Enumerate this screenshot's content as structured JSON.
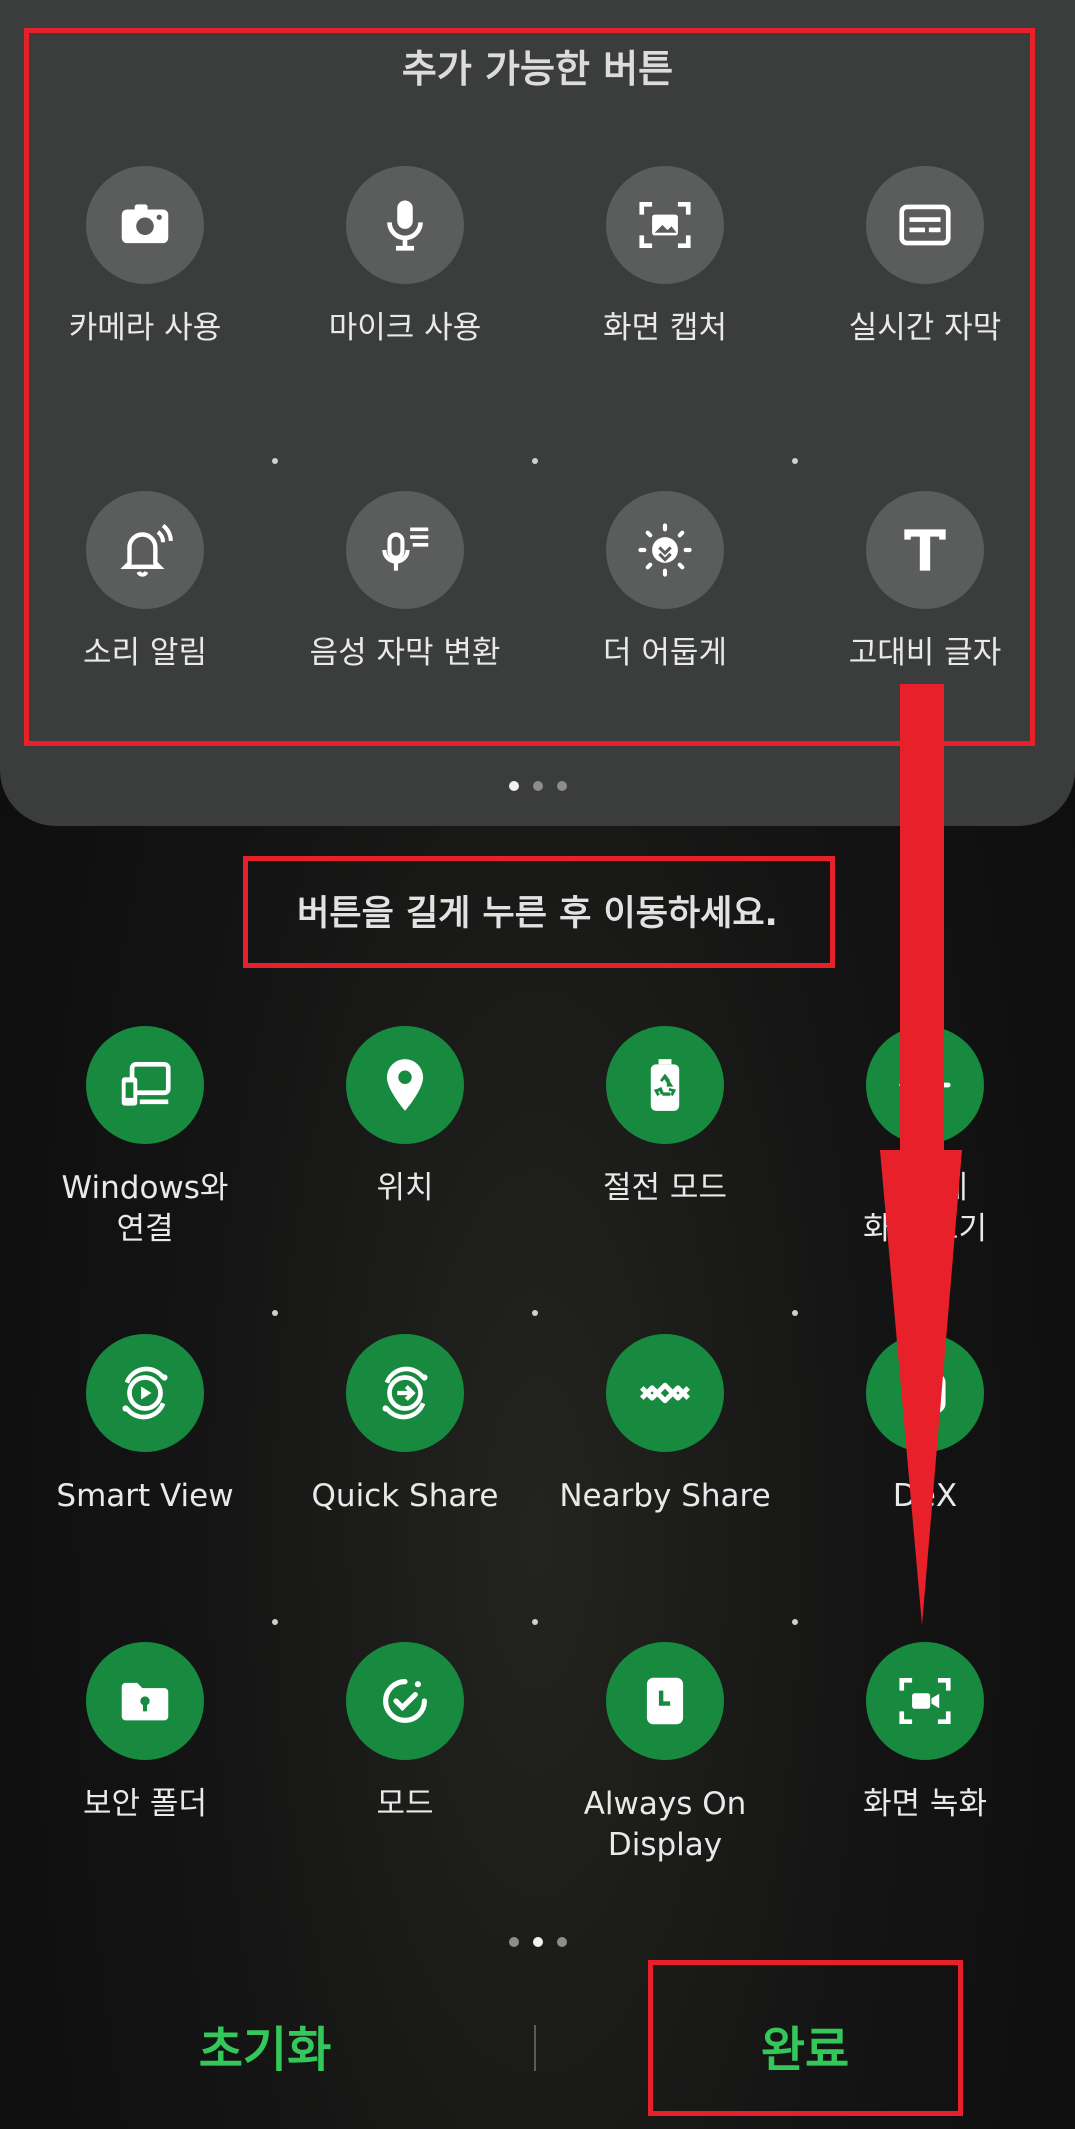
{
  "available_panel": {
    "title": "추가 가능한 버튼",
    "buttons": [
      {
        "label": "카메라 사용",
        "icon": "camera-icon"
      },
      {
        "label": "마이크 사용",
        "icon": "microphone-icon"
      },
      {
        "label": "화면 캡처",
        "icon": "screen-capture-icon"
      },
      {
        "label": "실시간 자막",
        "icon": "live-caption-icon"
      },
      {
        "label": "소리 알림",
        "icon": "sound-notification-icon"
      },
      {
        "label": "음성 자막 변환",
        "icon": "voice-to-caption-icon"
      },
      {
        "label": "더 어둡게",
        "icon": "extra-dim-icon"
      },
      {
        "label": "고대비 글자",
        "icon": "high-contrast-text-icon"
      }
    ]
  },
  "hint": "버튼을 길게 누른 후 이동하세요.",
  "active_buttons": [
    {
      "label": "Windows와\n연결",
      "icon": "link-to-windows-icon"
    },
    {
      "label": "위치",
      "icon": "location-icon"
    },
    {
      "label": "절전 모드",
      "icon": "power-saving-icon"
    },
    {
      "label": "편하게\n화면 보기",
      "icon": "eye-comfort-icon"
    },
    {
      "label": "Smart View",
      "icon": "smart-view-icon"
    },
    {
      "label": "Quick Share",
      "icon": "quick-share-icon"
    },
    {
      "label": "Nearby Share",
      "icon": "nearby-share-icon"
    },
    {
      "label": "DeX",
      "icon": "dex-icon"
    },
    {
      "label": "보안 폴더",
      "icon": "secure-folder-icon"
    },
    {
      "label": "모드",
      "icon": "modes-icon"
    },
    {
      "label": "Always On\nDisplay",
      "icon": "always-on-display-icon"
    },
    {
      "label": "화면 녹화",
      "icon": "screen-recorder-icon"
    }
  ],
  "footer": {
    "reset_label": "초기화",
    "done_label": "완료"
  },
  "colors": {
    "accent_green": "#34c759",
    "highlight_red": "#e8202a",
    "icon_green": "#178a40"
  }
}
